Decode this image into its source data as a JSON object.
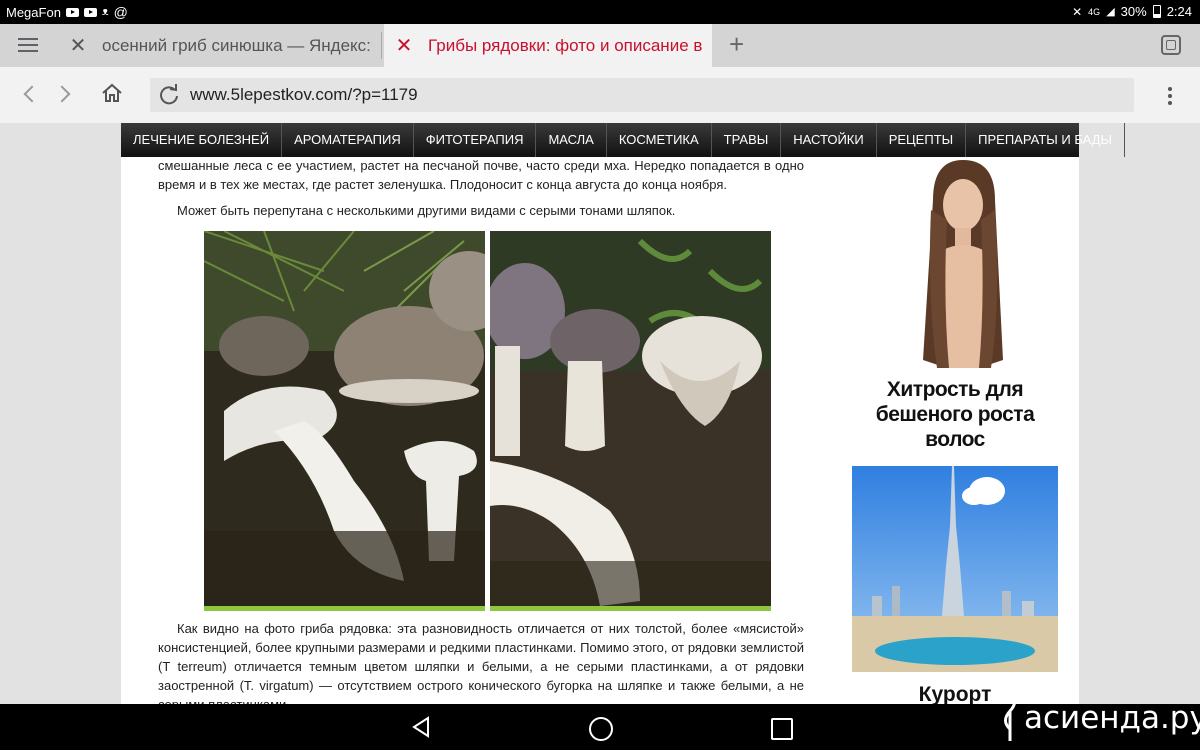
{
  "statusbar": {
    "carrier": "MegaFon",
    "notification_icons": [
      "youtube-icon",
      "youtube-icon",
      "ok-icon",
      "at-icon"
    ],
    "signal": "4G",
    "battery": "30%",
    "time": "2:24"
  },
  "tabs": [
    {
      "title": "осенний гриб синюшка — Яндекс:",
      "active": false
    },
    {
      "title": "Грибы рядовки: фото и описание в",
      "active": true
    }
  ],
  "address_bar": {
    "url": "www.5lepestkov.com/?p=1179"
  },
  "site_nav": {
    "items": [
      "ЛЕЧЕНИЕ БОЛЕЗНЕЙ",
      "АРОМАТЕРАПИЯ",
      "ФИТОТЕРАПИЯ",
      "МАСЛА",
      "КОСМЕТИКА",
      "ТРАВЫ",
      "НАСТОЙКИ",
      "РЕЦЕПТЫ",
      "ПРЕПАРАТЫ И БАДЫ"
    ]
  },
  "article": {
    "paragraph_top": "смешанные леса с ее участием, растет на песчаной почве, часто среди мха. Нередко попадается в одно время и в тех же местах, где растет зеленушка. Плодоносит с конца августа до конца ноября.",
    "paragraph_confusion": "Может быть перепутана с несколькими другими видами с серыми тонами шляпок.",
    "paragraph_bottom": "Как видно на фото гриба рядовка: эта разновидность отличается от них толстой, более «мясистой» консистенцией, более крупными размерами и редкими пластинками. Помимо этого, от рядовки землистой (T terreum) отличается темным цветом шляпки и белыми, а не серыми пластинками, а от рядовки заостренной (T. virgatum) — отсутствием острого конического бугорка на шляпке и также белыми, а не серыми пластинками."
  },
  "sidebar": {
    "ad1_title": "Хитрость для бешеного роста волос",
    "ad2_title": "Курорт"
  },
  "watermark": "асиенда.ру",
  "colors": {
    "accent_tab": "#c8102e",
    "nav_bg": "#1a1a1a",
    "photo_underline": "#8dc63f"
  }
}
